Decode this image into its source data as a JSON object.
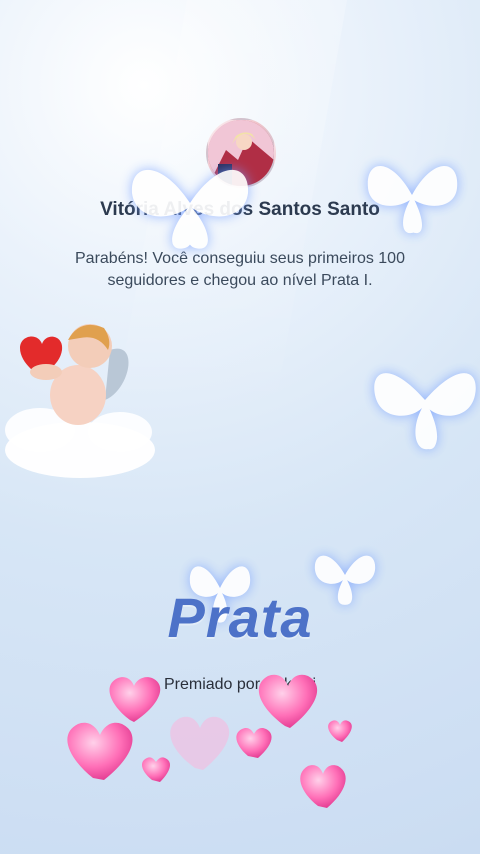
{
  "profile": {
    "name": "Vitória Alves dos Santos Santo",
    "avatar_icon": "avatar-icon"
  },
  "message": {
    "text": "Parabéns! Você conseguiu seus primeiros 100 seguidores e chegou ao nível Prata I."
  },
  "level": {
    "title": "Prata",
    "color": "#4d72c8"
  },
  "award": {
    "prefix": "Premiado por",
    "brand": "kwai",
    "brand_icon": "kwai-logo-icon",
    "brand_color": "#ff7a00"
  },
  "decorations": {
    "butterfly_icon": "butterfly-icon",
    "cupid_icon": "cupid-icon",
    "heart_icon": "heart-icon"
  }
}
